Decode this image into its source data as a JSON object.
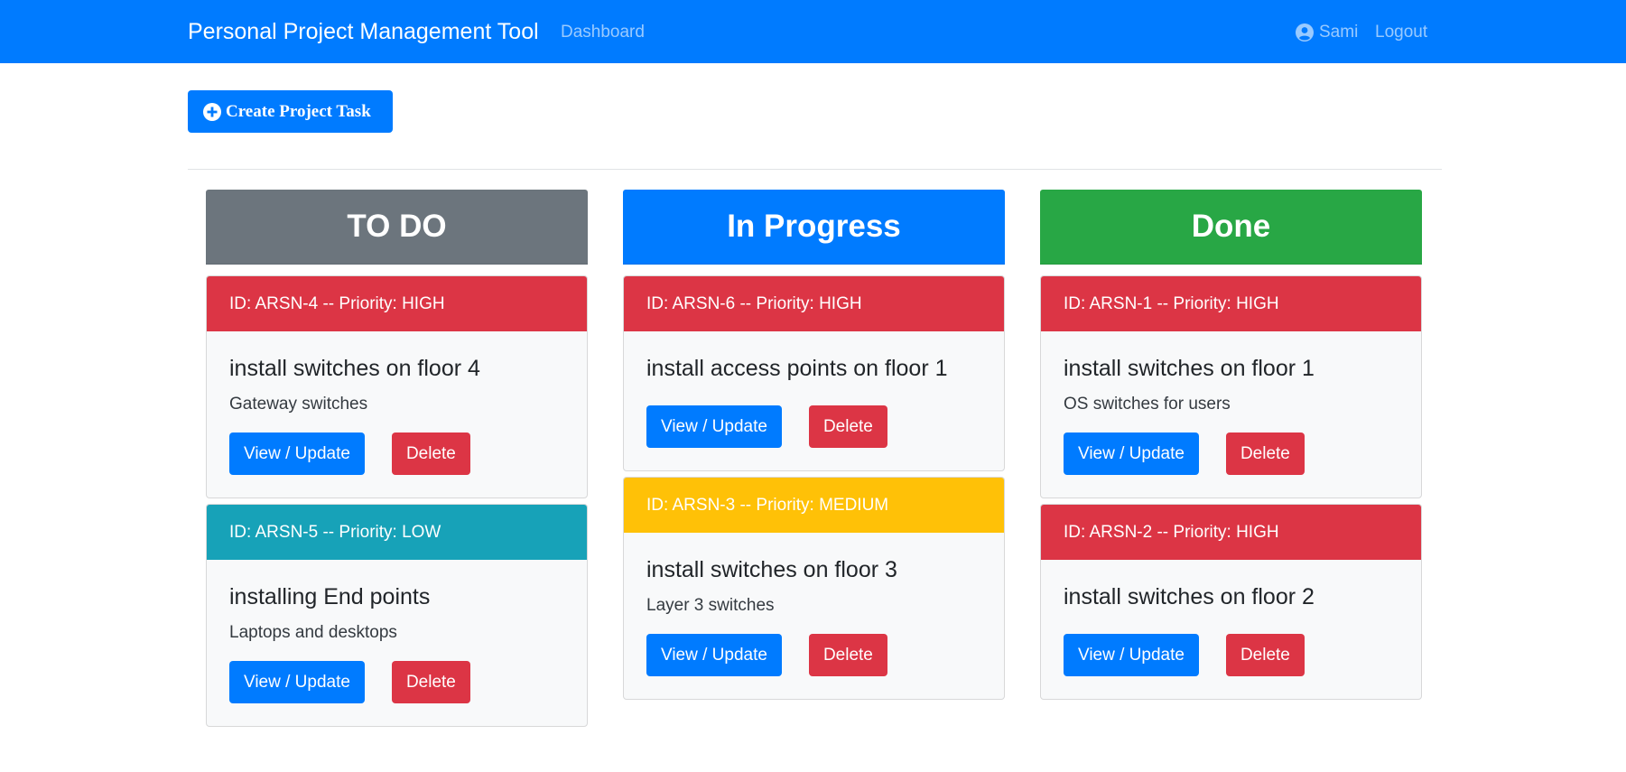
{
  "colors": {
    "navbar": "#007bff",
    "primary": "#007bff",
    "danger": "#dc3545",
    "info": "#17a2b8",
    "warning": "#ffc107",
    "secondary": "#6c757d",
    "success": "#28a745"
  },
  "navbar": {
    "brand": "Personal Project Management Tool",
    "dashboard": "Dashboard",
    "user_icon": "user-circle-icon",
    "user": "Sami",
    "logout": "Logout"
  },
  "toolbar": {
    "create_icon": "plus-circle-icon",
    "create_label": "Create Project Task"
  },
  "board": {
    "columns": [
      {
        "title": "TO DO",
        "color": "#6c757d",
        "tasks": [
          {
            "header": "ID: ARSN-4 -- Priority: HIGH",
            "priority_color": "#dc3545",
            "title": "install switches on floor 4",
            "description": "Gateway switches",
            "view_label": "View / Update",
            "delete_label": "Delete"
          },
          {
            "header": "ID: ARSN-5 -- Priority: LOW",
            "priority_color": "#17a2b8",
            "title": "installing End points",
            "description": "Laptops and desktops",
            "view_label": "View / Update",
            "delete_label": "Delete"
          }
        ]
      },
      {
        "title": "In Progress",
        "color": "#007bff",
        "tasks": [
          {
            "header": "ID: ARSN-6 -- Priority: HIGH",
            "priority_color": "#dc3545",
            "title": "install access points on floor 1",
            "description": "",
            "view_label": "View / Update",
            "delete_label": "Delete"
          },
          {
            "header": "ID: ARSN-3 -- Priority: MEDIUM",
            "priority_color": "#ffc107",
            "title": "install switches on floor 3",
            "description": "Layer 3 switches",
            "view_label": "View / Update",
            "delete_label": "Delete"
          }
        ]
      },
      {
        "title": "Done",
        "color": "#28a745",
        "tasks": [
          {
            "header": "ID: ARSN-1 -- Priority: HIGH",
            "priority_color": "#dc3545",
            "title": "install switches on floor 1",
            "description": "OS switches for users",
            "view_label": "View / Update",
            "delete_label": "Delete"
          },
          {
            "header": "ID: ARSN-2 -- Priority: HIGH",
            "priority_color": "#dc3545",
            "title": "install switches on floor 2",
            "description": "",
            "view_label": "View / Update",
            "delete_label": "Delete"
          }
        ]
      }
    ]
  }
}
